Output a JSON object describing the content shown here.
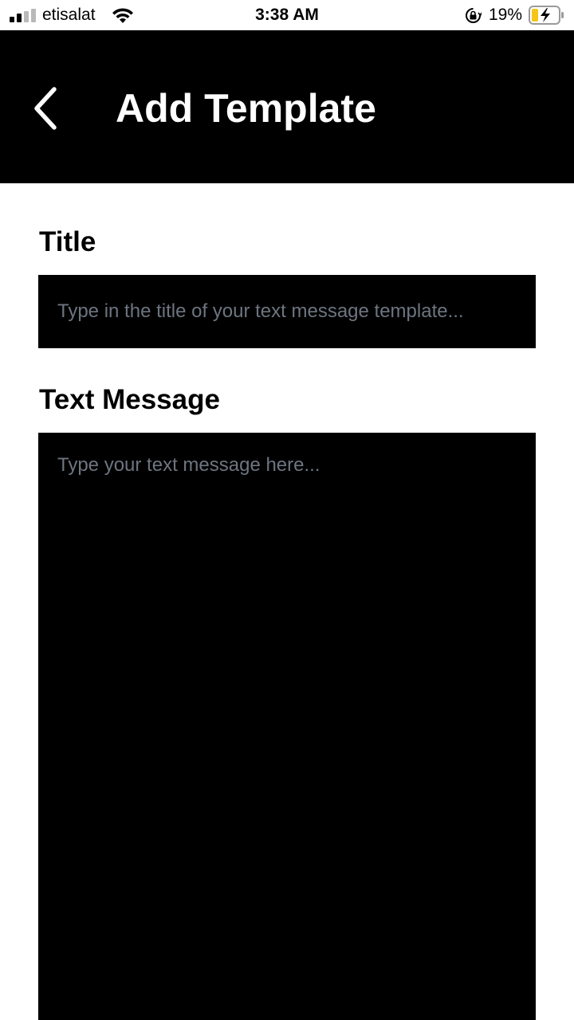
{
  "status_bar": {
    "carrier": "etisalat",
    "time": "3:38 AM",
    "battery_percent": "19%",
    "signal_bars_filled": 2,
    "signal_bars_total": 4,
    "icons": [
      "signal-icon",
      "wifi-icon",
      "rotation-lock-icon",
      "battery-charging-icon"
    ],
    "battery_color": "#f5c518"
  },
  "header": {
    "title": "Add Template",
    "back_icon": "chevron-left-icon",
    "background": "#000000"
  },
  "form": {
    "title_label": "Title",
    "title_placeholder": "Type in the title of your text message template...",
    "message_label": "Text Message",
    "message_placeholder": "Type your text message here..."
  }
}
